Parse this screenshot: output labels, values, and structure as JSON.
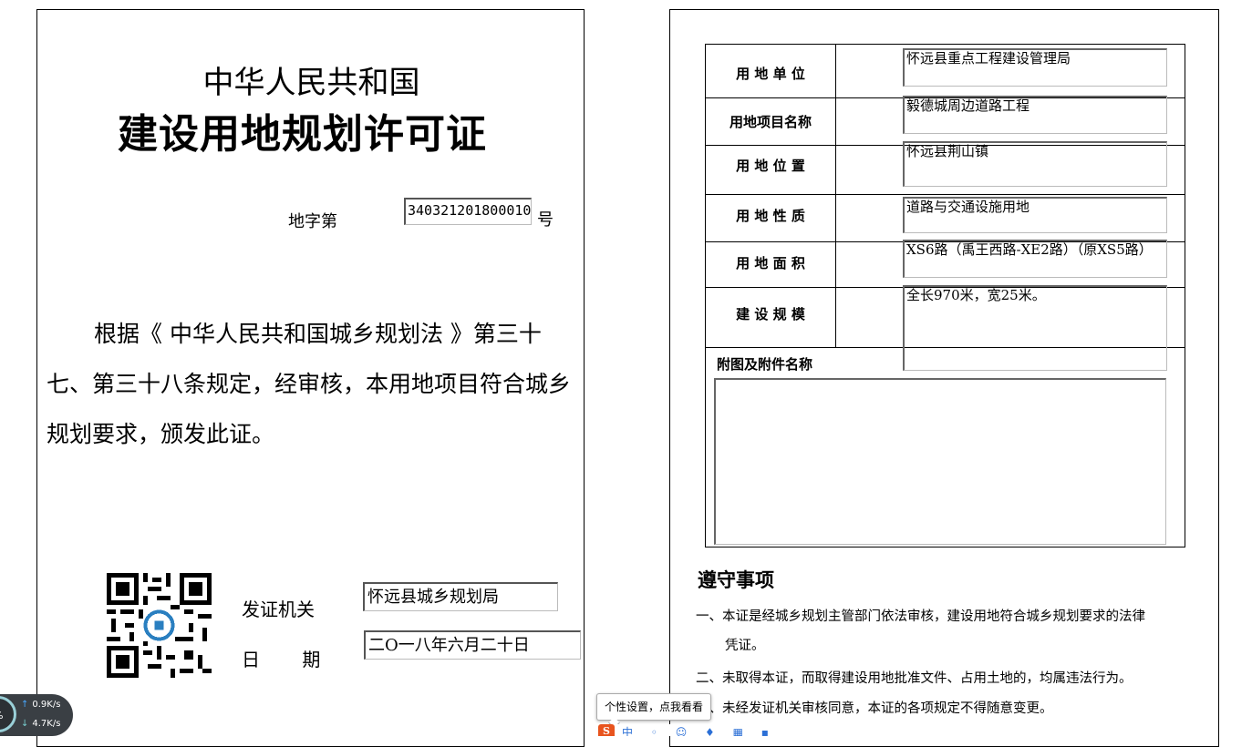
{
  "left_page": {
    "title_small": "中华人民共和国",
    "title_big": "建设用地规划许可证",
    "no_label": "地字第",
    "no_value": "340321201800010",
    "no_suffix": "号",
    "body": "根据《 中华人民共和国城乡规划法 》第三十七、第三十八条规定，经审核，本用地项目符合城乡规划要求，颁发此证。",
    "issuer_label": "发证机关",
    "issuer_value": "怀远县城乡规划局",
    "date_label": "日 期",
    "date_value": "二O一八年六月二十日"
  },
  "right_page": {
    "rows": [
      {
        "label": "用 地 单 位",
        "value": "怀远县重点工程建设管理局"
      },
      {
        "label": "用地项目名称",
        "value": "毅德城周边道路工程"
      },
      {
        "label": "用 地 位 置",
        "value": "怀远县荆山镇"
      },
      {
        "label": "用 地 性 质",
        "value": "道路与交通设施用地"
      },
      {
        "label": "用 地 面 积",
        "value": "XS6路（禹王西路-XE2路）（原XS5路）"
      },
      {
        "label": "建 设  规 模",
        "value": "全长970米，宽25米。"
      }
    ],
    "attach_label": "附图及附件名称",
    "notice_title": "遵守事项",
    "notices": [
      {
        "no": "一、",
        "text": "本证是经城乡规划主管部门依法审核，建设用地符合城乡规划要求的法律",
        "cont": "凭证。"
      },
      {
        "no": "二、",
        "text": "未取得本证，而取得建设用地批准文件、占用土地的，均属违法行为。"
      },
      {
        "no": "三、",
        "text": "未经发证机关审核同意，本证的各项规定不得随意变更。"
      }
    ]
  },
  "overlay": {
    "net_percent": "%",
    "upload_speed": "0.9K/s",
    "download_speed": "4.7K/s",
    "tooltip": "个性设置，点我看看",
    "ime_logo": "S",
    "ime_icons": "中 ◦ ☺ ♦ ▦ ▪ ✿ ▩"
  }
}
